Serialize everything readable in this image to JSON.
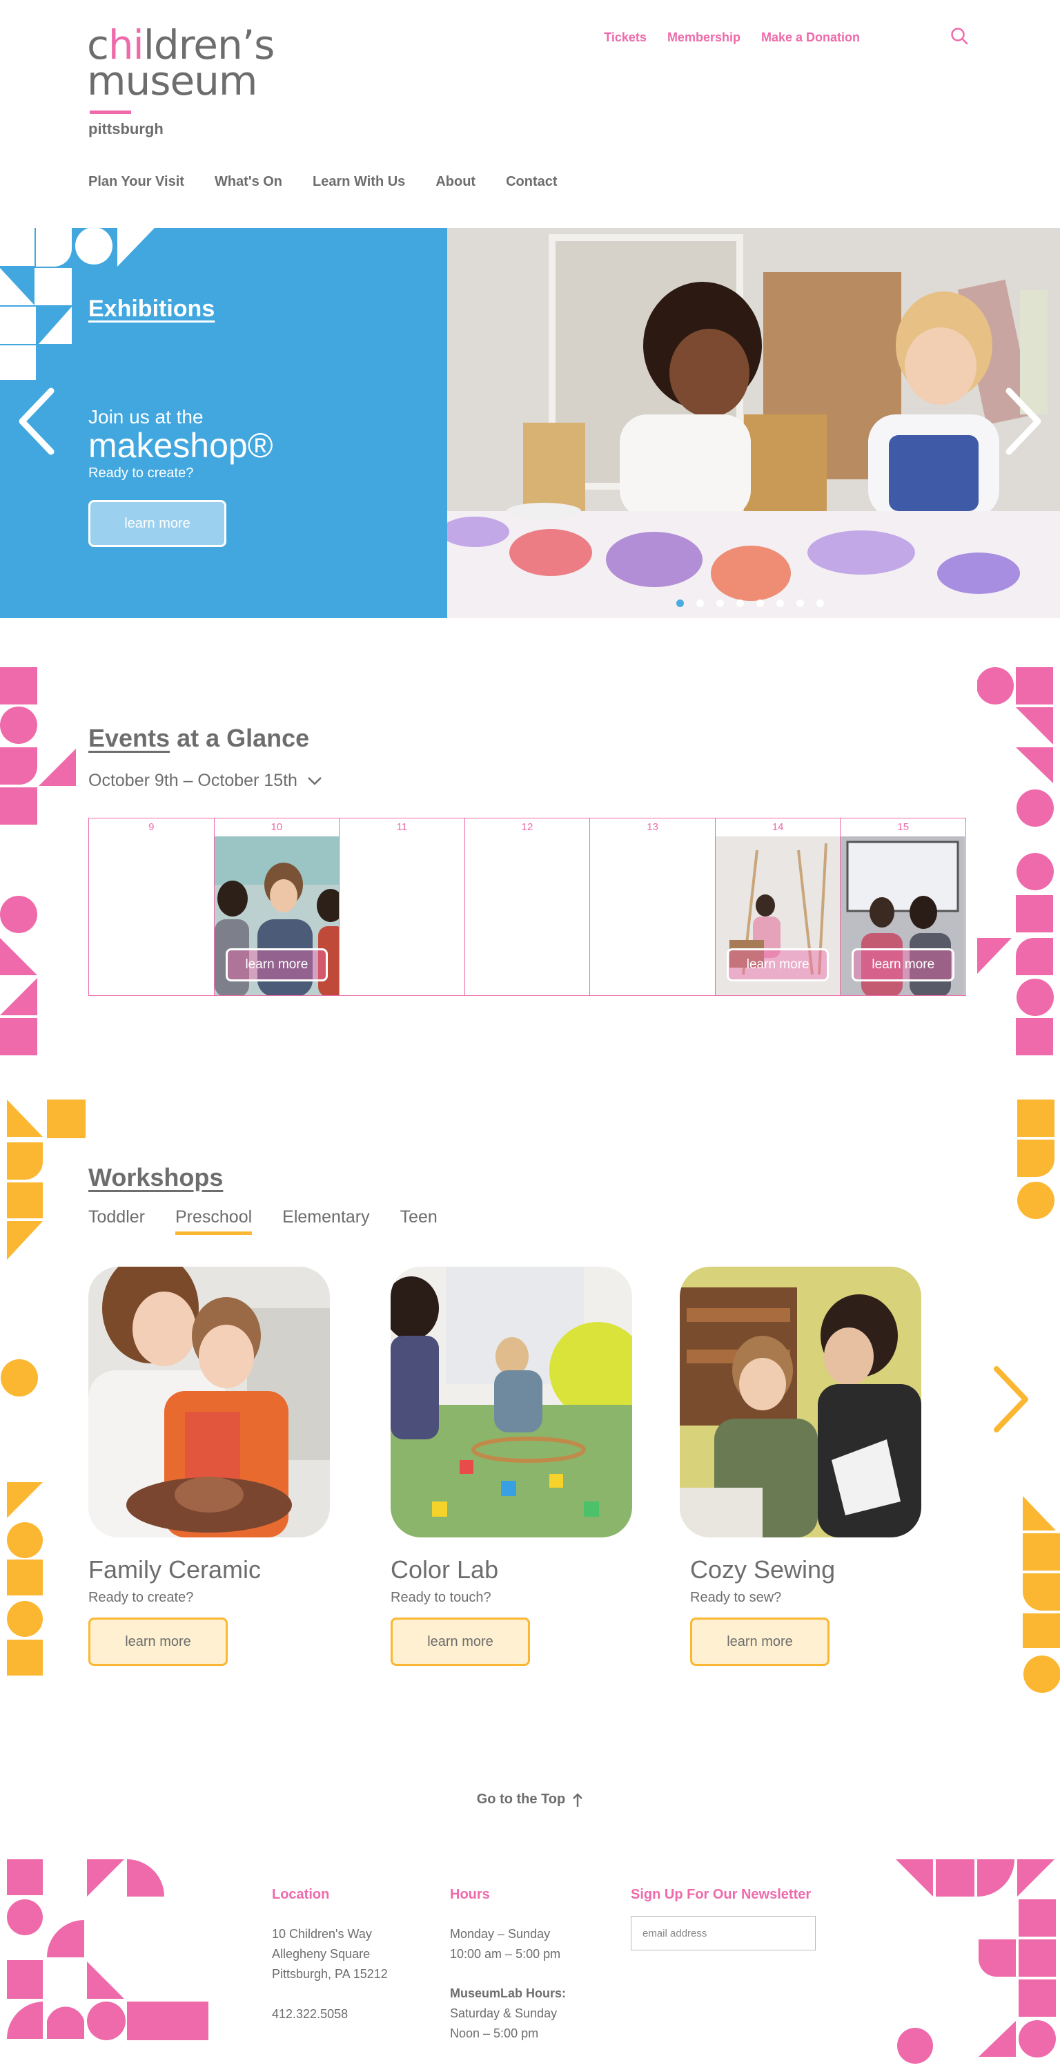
{
  "header": {
    "logo": {
      "line1_pre": "c",
      "line1_accent": "hi",
      "line1_post": "ldren’s",
      "line2": "museum",
      "line3": "pittsburgh"
    },
    "utility_nav": [
      "Tickets",
      "Membership",
      "Make a Donation"
    ],
    "search_icon": "search-icon",
    "main_nav": [
      "Plan Your Visit",
      "What's On",
      "Learn With Us",
      "About",
      "Contact"
    ]
  },
  "hero": {
    "category": "Exhibitions",
    "subtitle": "Join us at the",
    "title": "makeshop®",
    "tagline": "Ready to create?",
    "button": "learn more",
    "slide_count": 8,
    "active_slide": 0
  },
  "events": {
    "heading_underlined": "Events",
    "heading_rest": " at a Glance",
    "week_range": "October 9th – October 15th",
    "days": [
      {
        "num": "9",
        "has_event": false
      },
      {
        "num": "10",
        "has_event": true,
        "button": "learn more"
      },
      {
        "num": "11",
        "has_event": false
      },
      {
        "num": "12",
        "has_event": false
      },
      {
        "num": "13",
        "has_event": false
      },
      {
        "num": "14",
        "has_event": true,
        "button": "learn more"
      },
      {
        "num": "15",
        "has_event": true,
        "button": "learn more"
      }
    ]
  },
  "workshops": {
    "heading": "Workshops",
    "tabs": [
      "Toddler",
      "Preschool",
      "Elementary",
      "Teen"
    ],
    "active_tab": 1,
    "cards": [
      {
        "title": "Family Ceramic",
        "subtitle": "Ready to create?",
        "button": "learn more"
      },
      {
        "title": "Color Lab",
        "subtitle": "Ready to touch?",
        "button": "learn more"
      },
      {
        "title": "Cozy Sewing",
        "subtitle": "Ready to sew?",
        "button": "learn more"
      }
    ]
  },
  "go_top": "Go to the Top",
  "footer": {
    "location": {
      "heading": "Location",
      "line1": "10 Children's Way",
      "line2": "Allegheny Square",
      "line3": "Pittsburgh, PA 15212",
      "phone": "412.322.5058"
    },
    "hours": {
      "heading": "Hours",
      "line1": "Monday – Sunday",
      "line2": "10:00 am – 5:00 pm",
      "lab_heading": "MuseumLab Hours:",
      "lab_line1": "Saturday & Sunday",
      "lab_line2": "Noon – 5:00 pm"
    },
    "newsletter": {
      "heading": "Sign Up For Our Newsletter",
      "placeholder": "email address"
    }
  },
  "colors": {
    "pink": "#ee6aaa",
    "blue": "#41a7de",
    "yellow": "#fbb731",
    "gray": "#6d6d6d"
  }
}
